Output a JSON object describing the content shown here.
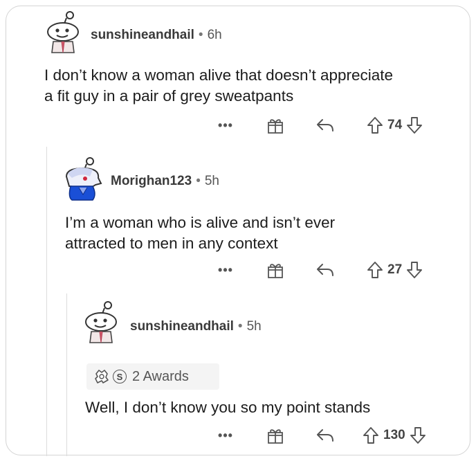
{
  "comments": [
    {
      "username": "sunshineandhail",
      "separator": "•",
      "time": "6h",
      "body_line1": "I don’t know a woman alive that doesn’t appreciate",
      "body_line2": "a fit guy in a pair of grey sweatpants",
      "more": "•••",
      "score": "74",
      "avatar_icon": "snoo-avatar-icon"
    },
    {
      "username": "Morighan123",
      "separator": "•",
      "time": "5h",
      "body_line1": "I’m a woman who is alive and isn’t ever",
      "body_line2": "attracted to men in any context",
      "more": "•••",
      "score": "27",
      "avatar_icon": "snoo-avatar-blue-icon",
      "avatar_color": "#1a4fd6"
    },
    {
      "username": "sunshineandhail",
      "separator": "•",
      "time": "5h",
      "awards_label": "2 Awards",
      "awards_coin_letter": "S",
      "body_line1": "Well, I don’t know you so my point stands",
      "more": "•••",
      "score": "130",
      "avatar_icon": "snoo-avatar-icon"
    }
  ],
  "colors": {
    "text": "#1c1c1c",
    "meta": "#555555",
    "icon": "#555555",
    "thread_line": "#dcdcdc",
    "card_border": "#d4d4d4"
  }
}
